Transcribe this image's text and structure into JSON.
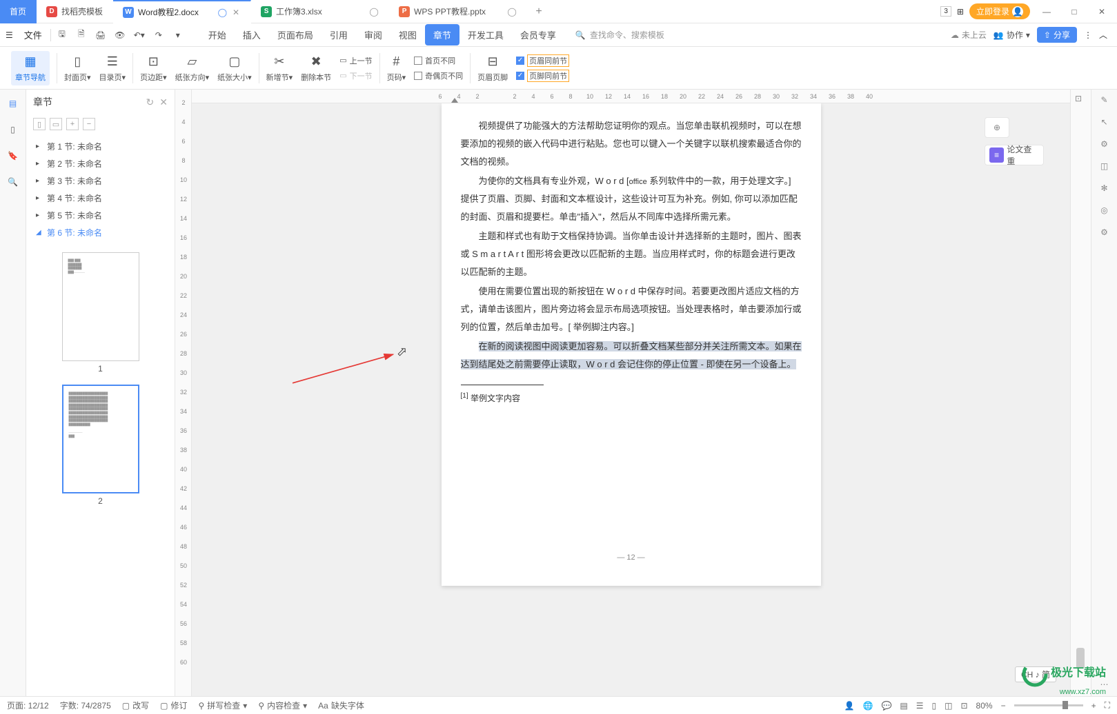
{
  "titleBar": {
    "homeTab": "首页",
    "tabs": [
      {
        "icon": "D",
        "iconColor": "#e64a45",
        "label": "找稻壳模板"
      },
      {
        "icon": "W",
        "iconColor": "#4a8bf4",
        "label": "Word教程2.docx",
        "active": true
      },
      {
        "icon": "S",
        "iconColor": "#1fa463",
        "label": "工作簿3.xlsx"
      },
      {
        "icon": "P",
        "iconColor": "#ed6d46",
        "label": "WPS PPT教程.pptx"
      }
    ],
    "loginLabel": "立即登录"
  },
  "menuBar": {
    "fileLabel": "文件",
    "tabs": [
      "开始",
      "插入",
      "页面布局",
      "引用",
      "审阅",
      "视图",
      "章节",
      "开发工具",
      "会员专享"
    ],
    "activeTab": "章节",
    "searchPlaceholder": "查找命令、搜索模板",
    "cloudLabel": "未上云",
    "collabLabel": "协作",
    "shareLabel": "分享"
  },
  "ribbon": {
    "navPane": "章节导航",
    "coverPage": "封面页",
    "contents": "目录页",
    "margins": "页边距",
    "orientation": "纸张方向",
    "paperSize": "纸张大小",
    "newSection": "新增节",
    "deleteSection": "删除本节",
    "prevSection": "上一节",
    "nextSection": "下一节",
    "pageNumber": "页码",
    "firstDiff": "首页不同",
    "oddEvenDiff": "奇偶页不同",
    "headerFooter": "页眉页脚",
    "headerSame": "页眉同前节",
    "footerSame": "页脚同前节"
  },
  "sidePanel": {
    "title": "章节",
    "items": [
      {
        "label": "第 1 节: 未命名"
      },
      {
        "label": "第 2 节: 未命名"
      },
      {
        "label": "第 3 节: 未命名"
      },
      {
        "label": "第 4 节: 未命名"
      },
      {
        "label": "第 5 节: 未命名"
      },
      {
        "label": "第 6 节: 未命名",
        "active": true
      }
    ],
    "thumbNums": [
      "1",
      "2"
    ]
  },
  "rulerH": [
    "6",
    "4",
    "2",
    "",
    "2",
    "4",
    "6",
    "8",
    "10",
    "12",
    "14",
    "16",
    "18",
    "20",
    "22",
    "24",
    "26",
    "28",
    "30",
    "32",
    "34",
    "36",
    "38",
    "40"
  ],
  "rulerV": [
    "2",
    "4",
    "6",
    "8",
    "10",
    "12",
    "14",
    "16",
    "18",
    "20",
    "22",
    "24",
    "26",
    "28",
    "30",
    "32",
    "34",
    "36",
    "38",
    "40",
    "42",
    "44",
    "46",
    "48",
    "50",
    "52",
    "54",
    "56",
    "58",
    "60"
  ],
  "document": {
    "p1": "视频提供了功能强大的方法帮助您证明你的观点。当您单击联机视频时，可以在想要添加的视频的嵌入代码中进行粘贴。您也可以键入一个关键字以联机搜索最适合你的文档的视频。",
    "p2_a": "为使你的文档具有专业外观，W o r d [",
    "p2_b": " 系列软件中的一款，用于处理文字。]    提供了页眉、页脚、封面和文本框设计，这些设计可互为补充。例如, 你可以添加匹配的封面、页眉和提要栏。单击\"插入\"，然后从不同库中选择所需元素。",
    "p2_office": "office",
    "p3": "主题和样式也有助于文档保持协调。当你单击设计并选择新的主题时，图片、图表或   S m a r t A r t    图形将会更改以匹配新的主题。当应用样式时，你的标题会进行更改以匹配新的主题。",
    "p4": "使用在需要位置出现的新按钮在   W o r d 中保存时间。若要更改图片适应文档的方式，请单击该图片，图片旁边将会显示布局选项按钮。当处理表格时，单击要添加行或列的位置，然后单击加号。[ 举例脚注内容。]",
    "p5": "在新的阅读视图中阅读更加容易。可以折叠文档某些部分并关注所需文本。如果在达到结尾处之前需要停止读取，W o r d   会记住你的停止位置   -  即使在另一个设备上。",
    "footnoteRef": "[1]",
    "footnoteText": " 举例文字内容",
    "pageNum": "— 12 —"
  },
  "imeBadge": "CH ♪ 简",
  "rightTools": {
    "essayCheck": "论文查重"
  },
  "statusBar": {
    "page": "页面: 12/12",
    "words": "字数: 74/2875",
    "overwrite": "改写",
    "revision": "修订",
    "spellCheck": "拼写检查",
    "contentCheck": "内容检查",
    "missingFont": "缺失字体",
    "zoom": "80%"
  },
  "watermark": {
    "line1": "极光下载站",
    "line2": "www.xz7.com"
  }
}
